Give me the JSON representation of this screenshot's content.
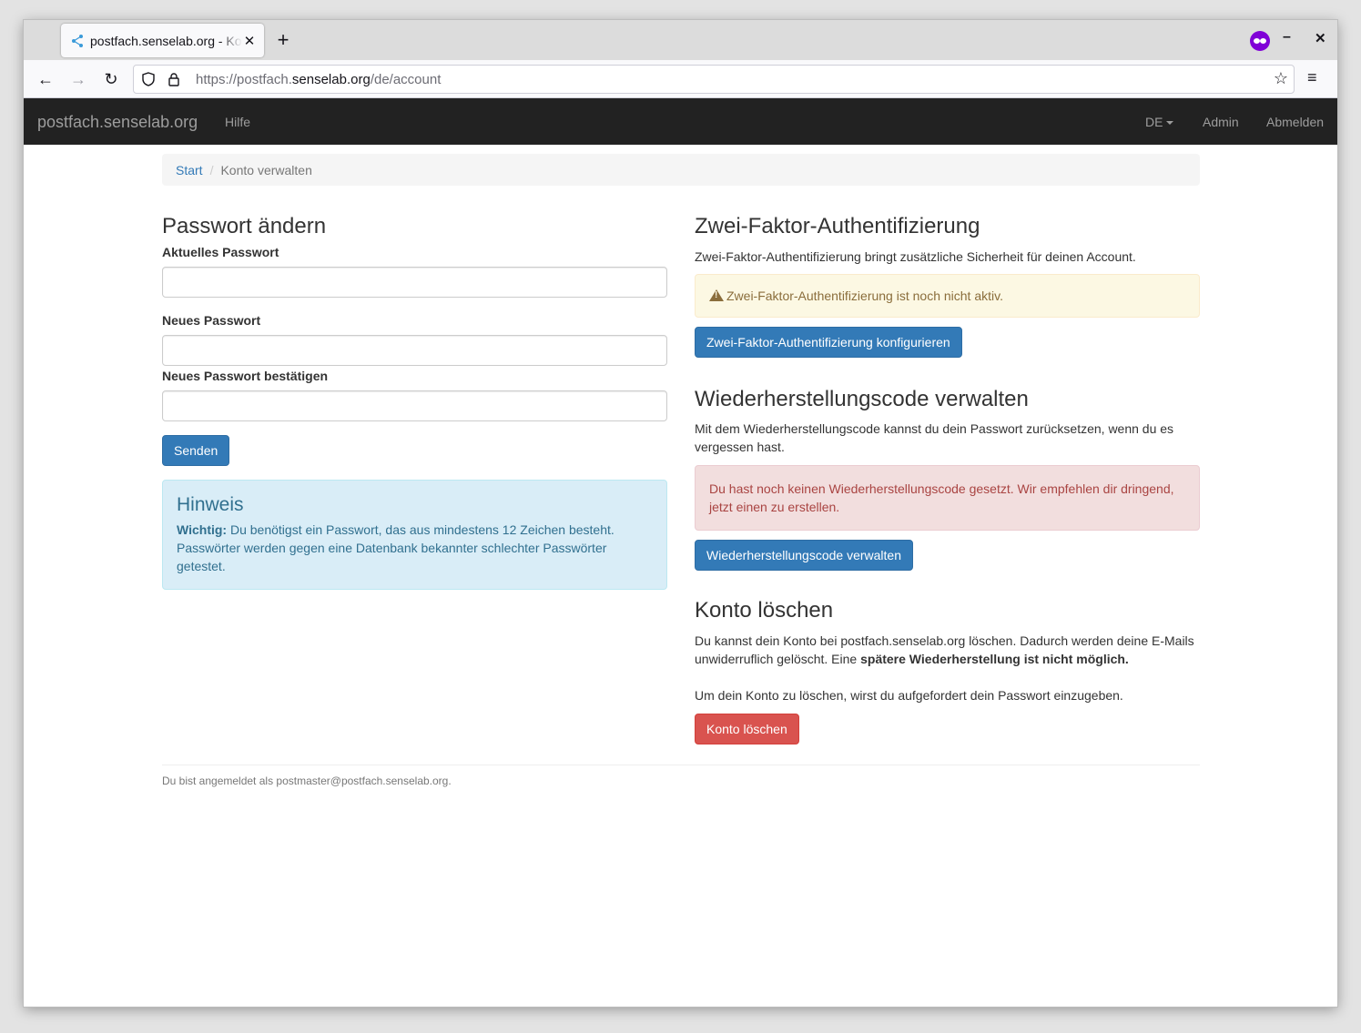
{
  "browser": {
    "tab_title": "postfach.senselab.org - Konto verwalten",
    "url_scheme": "https://postfach.",
    "url_domain": "senselab.org",
    "url_path": "/de/account"
  },
  "navbar": {
    "brand": "postfach.senselab.org",
    "help": "Hilfe",
    "language": "DE",
    "admin": "Admin",
    "logout": "Abmelden"
  },
  "breadcrumb": {
    "start": "Start",
    "separator": "/",
    "current": "Konto verwalten"
  },
  "password": {
    "title": "Passwort ändern",
    "current_label": "Aktuelles Passwort",
    "new_label": "Neues Passwort",
    "confirm_label": "Neues Passwort bestätigen",
    "submit": "Senden",
    "hint_title": "Hinweis",
    "hint_strong": "Wichtig:",
    "hint_text": " Du benötigst ein Passwort, das aus mindestens 12 Zeichen besteht. Passwörter werden gegen eine ",
    "hint_link": "Datenbank bekannter schlechter Passwörter",
    "hint_end": " getestet."
  },
  "twofa": {
    "title": "Zwei-Faktor-Authentifizierung",
    "description": "Zwei-Faktor-Authentifizierung bringt zusätzliche Sicherheit für deinen Account.",
    "warning": "Zwei-Faktor-Authentifizierung ist noch nicht aktiv.",
    "button": "Zwei-Faktor-Authentifizierung konfigurieren"
  },
  "recovery": {
    "title": "Wiederherstellungscode verwalten",
    "description": "Mit dem Wiederherstellungscode kannst du dein Passwort zurücksetzen, wenn du es vergessen hast.",
    "alert": "Du hast noch keinen Wiederherstellungscode gesetzt. Wir empfehlen dir dringend, jetzt einen zu erstellen.",
    "button": "Wiederherstellungscode verwalten"
  },
  "delete": {
    "title": "Konto löschen",
    "text1": "Du kannst dein Konto bei postfach.senselab.org löschen. Dadurch werden deine E-Mails unwiderruflich gelöscht. Eine ",
    "text1_strong": "spätere Wiederherstellung ist nicht möglich.",
    "text2": "Um dein Konto zu löschen, wirst du aufgefordert dein Passwort einzugeben.",
    "button": "Konto löschen"
  },
  "footer": {
    "text": "Du bist angemeldet als postmaster@postfach.senselab.org."
  },
  "colors": {
    "navbar_bg": "#222222",
    "primary": "#337ab7",
    "danger": "#d9534f",
    "info_bg": "#d9edf7",
    "warning_bg": "#fcf8e3",
    "danger_bg": "#f2dede"
  }
}
